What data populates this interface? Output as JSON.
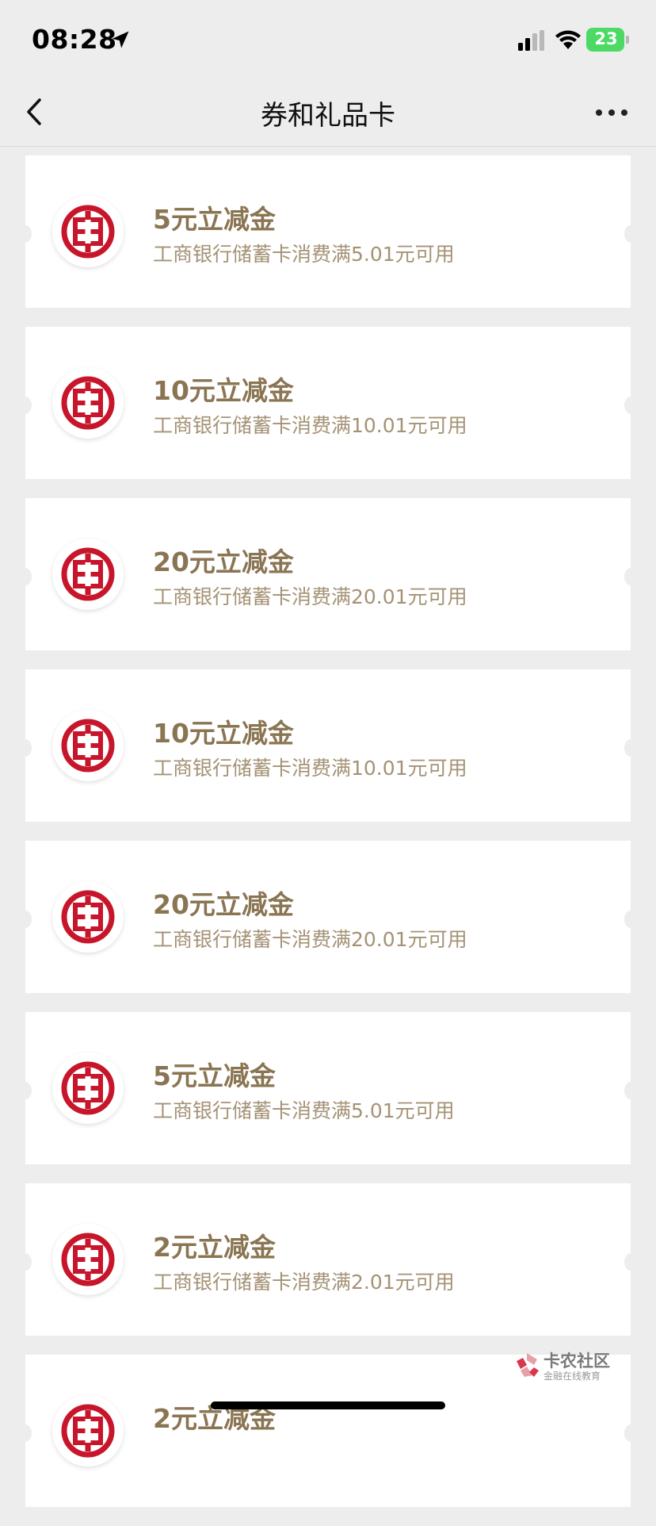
{
  "status_bar": {
    "time": "08:28",
    "battery": "23",
    "icons": [
      "location-arrow-icon",
      "cellular-signal-icon",
      "wifi-icon",
      "battery-charging-icon"
    ]
  },
  "nav": {
    "title": "券和礼品卡",
    "back_icon": "chevron-left-icon",
    "more_icon": "more-dots-icon"
  },
  "coupons": [
    {
      "title": "5元立减金",
      "desc": "工商银行储蓄卡消费满5.01元可用"
    },
    {
      "title": "10元立减金",
      "desc": "工商银行储蓄卡消费满10.01元可用"
    },
    {
      "title": "20元立减金",
      "desc": "工商银行储蓄卡消费满20.01元可用"
    },
    {
      "title": "10元立减金",
      "desc": "工商银行储蓄卡消费满10.01元可用"
    },
    {
      "title": "20元立减金",
      "desc": "工商银行储蓄卡消费满20.01元可用"
    },
    {
      "title": "5元立减金",
      "desc": "工商银行储蓄卡消费满5.01元可用"
    },
    {
      "title": "2元立减金",
      "desc": "工商银行储蓄卡消费满2.01元可用"
    },
    {
      "title": "2元立减金",
      "desc": ""
    }
  ],
  "watermark": {
    "title": "卡农社区",
    "subtitle": "金融在线教育"
  },
  "colors": {
    "accent_gold": "#8a7552",
    "icbc_red": "#c7162b",
    "battery_green": "#4cd964"
  }
}
